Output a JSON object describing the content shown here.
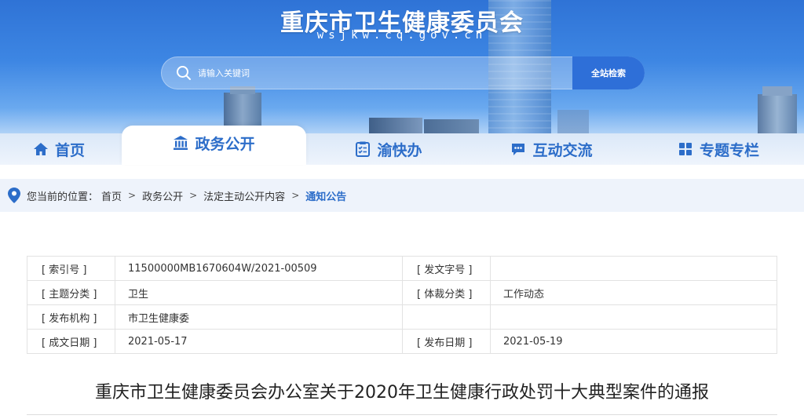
{
  "header": {
    "title": "重庆市卫生健康委员会",
    "domain": "wsjkw.cq.gov.cn",
    "search": {
      "placeholder": "请输入关键词",
      "button_label": "全站检索"
    }
  },
  "nav": {
    "items": [
      {
        "label": "首页",
        "icon": "home-icon",
        "active": false
      },
      {
        "label": "政务公开",
        "icon": "government-building-icon",
        "active": true
      },
      {
        "label": "渝快办",
        "icon": "checklist-icon",
        "active": false
      },
      {
        "label": "互动交流",
        "icon": "chat-bubble-icon",
        "active": false
      },
      {
        "label": "专题专栏",
        "icon": "grid-icon",
        "active": false
      }
    ]
  },
  "breadcrumb": {
    "prefix": "您当前的位置：",
    "items": [
      "首页",
      "政务公开",
      "法定主动公开内容",
      "通知公告"
    ],
    "separator": ">"
  },
  "info_table": {
    "rows": [
      {
        "k1": "[ 索引号 ]",
        "v1": "11500000MB1670604W/2021-00509",
        "k2": "[ 发文字号 ]",
        "v2": ""
      },
      {
        "k1": "[ 主题分类 ]",
        "v1": "卫生",
        "k2": "[ 体裁分类 ]",
        "v2": "工作动态"
      },
      {
        "k1": "[ 发布机构 ]",
        "v1": "市卫生健康委",
        "k2": "",
        "v2": ""
      },
      {
        "k1": "[ 成文日期 ]",
        "v1": "2021-05-17",
        "k2": "[ 发布日期 ]",
        "v2": "2021-05-19"
      }
    ]
  },
  "document": {
    "title": "重庆市卫生健康委员会办公室关于2020年卫生健康行政处罚十大典型案件的通报"
  },
  "colors": {
    "brand_blue": "#2c6dc9",
    "search_button": "#2e6fd8",
    "breadcrumb_bg": "#eef3fb"
  }
}
